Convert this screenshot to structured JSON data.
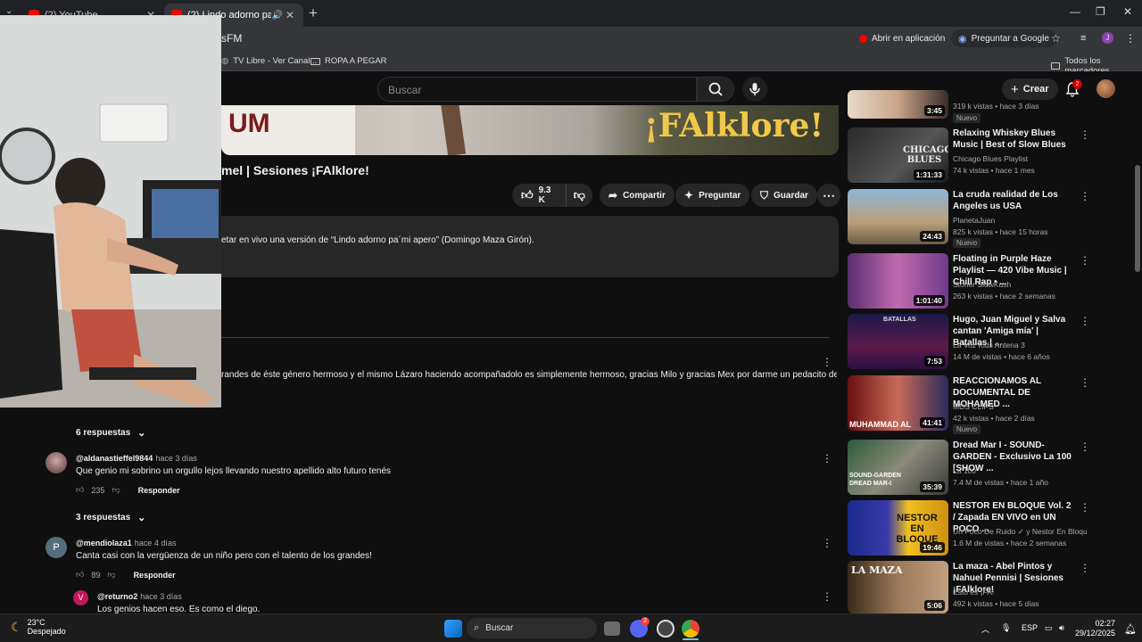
{
  "browser": {
    "tabs": [
      {
        "title": "(2) YouTube",
        "active": false
      },
      {
        "title": "(2) Lindo adorno pa'mi ape",
        "active": true
      }
    ],
    "url_fragment": "sFM",
    "open_in_app": "Abrir en aplicación",
    "ask_google": "Preguntar a Google",
    "profile_initial": "J",
    "bookmarks": [
      {
        "label": "TV Libre - Ver Canal..."
      },
      {
        "label": "ROPA A PEGAR"
      }
    ],
    "all_bookmarks": "Todos los marcadores"
  },
  "youtube": {
    "search_placeholder": "Buscar",
    "create_label": "Crear",
    "notification_count": "2"
  },
  "video": {
    "banner_title": "¡FAlklore!",
    "banner_left": "UM",
    "title": "mel | Sesiones ¡FAlklore!",
    "likes": "9.3 K",
    "share": "Compartir",
    "ask": "Preguntar",
    "save": "Guardar",
    "description": "etar en vivo una versión de “Lindo adorno pa´mi apero” (Domingo Maza Girón)."
  },
  "comments": {
    "top_comment_text": "randes de éste género hermoso y el mismo Lázaro haciendo acompañadolo es simplemente hermoso, gracias Milo y gracias Mex por darme un pedacito de mi tierra a",
    "reply_label": "Responder",
    "items": [
      {
        "replies": "6 respuestas"
      },
      {
        "handle": "@aldanastieffel9844",
        "date": "hace 3 días",
        "text": "Que genio mi sobrino un orgullo lejos llevando nuestro apellido alto futuro tenés",
        "likes": "235",
        "replies": "3 respuestas"
      },
      {
        "handle": "@mendiolaza1",
        "date": "hace 4 días",
        "text": "Canta casi con la vergüenza de un niño pero con el talento de los grandes!",
        "likes": "89",
        "avatar_letter": "P"
      },
      {
        "handle": "@returno2",
        "date": "hace 3 días",
        "text": "Los genios hacen eso. Es como el diego.",
        "avatar_letter": "V"
      }
    ]
  },
  "recommendations": [
    {
      "title": "",
      "channel": "",
      "meta": "319 k vistas • hace 3 días",
      "duration": "3:45",
      "badge": "Nuevo"
    },
    {
      "title": "Relaxing Whiskey Blues Music | Best of Slow Blues",
      "channel": "Chicago Blues Playlist",
      "meta": "74 k vistas • hace 1 mes",
      "duration": "1:31:33",
      "thumb_text": "CHICAGO BLUES"
    },
    {
      "title": "La cruda realidad de Los Angeles us USA",
      "channel": "PlanetaJuan",
      "meta": "825 k vistas • hace 15 horas",
      "duration": "24:43",
      "badge": "Nuevo"
    },
    {
      "title": "Floating in Purple Haze Playlist — 420 Vibe Music | Chill Rap • ...",
      "channel": "Stoner SlowKush",
      "meta": "263 k vistas • hace 2 semanas",
      "duration": "1:01:40"
    },
    {
      "title": "Hugo, Juan Miguel y Salva cantan 'Amiga mía' | Batallas | ...",
      "channel": "La Voz Kids Antena 3",
      "meta": "14 M de vistas • hace 6 años",
      "duration": "7:53",
      "thumb_text": "BATALLAS"
    },
    {
      "title": "REACCIONAMOS AL DOCUMENTAL DE MOHAMED ...",
      "channel": "MDS CLIPS",
      "meta": "42 k vistas • hace 2 días",
      "duration": "41:41",
      "badge": "Nuevo",
      "thumb_text": "MUHAMMAD AL"
    },
    {
      "title": "Dread Mar I - SOUND-GARDEN - Exclusivo La 100 [SHOW ...",
      "channel": "La 100",
      "meta": "7.4 M de vistas • hace 1 año",
      "duration": "35:39",
      "thumb_text": "SOUND-GARDEN DREAD MAR-I"
    },
    {
      "title": "NESTOR EN BLOQUE Vol. 2 / Zapada EN VIVO en UN POCO ...",
      "channel": "Un Poco De Ruido ✓ y Nestor En Bloque.",
      "meta": "1.6 M de vistas • hace 2 semanas",
      "duration": "19:46",
      "thumb_text": "NESTOR EN BLOQUE"
    },
    {
      "title": "La maza - Abel Pintos y Nahuel Pennisi | Sesiones ¡FAlklore!",
      "channel": "Esto es ¡FA!",
      "meta": "492 k vistas • hace 5 días",
      "duration": "5:06",
      "thumb_text": "LA MAZA"
    }
  ],
  "taskbar": {
    "weather_temp": "23°C",
    "weather_desc": "Despejado",
    "search": "Buscar",
    "language": "ESP",
    "time": "02:27",
    "date": "29/12/2025",
    "discord_badge": "2"
  },
  "colors": {
    "accent_red": "#ff0000",
    "bg": "#0f0f0f",
    "surface": "#272727"
  }
}
